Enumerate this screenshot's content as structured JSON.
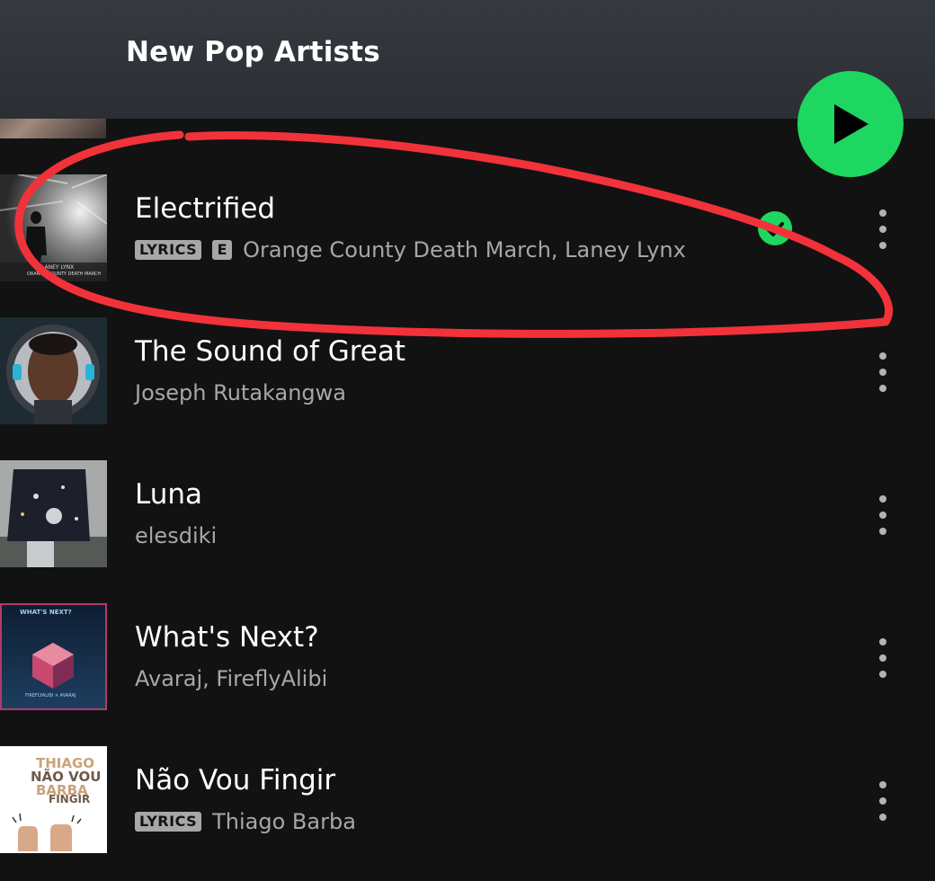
{
  "header": {
    "title": "New Pop Artists"
  },
  "play_button": {
    "icon": "play-icon",
    "color": "#1ed760"
  },
  "tracks": [
    {
      "title": "Electrified",
      "lyrics_badge": "LYRICS",
      "explicit_badge": "E",
      "artists": "Orange County Death March, Laney Lynx",
      "downloaded": true,
      "art_text_top": "LANEY LYNX",
      "art_text_bottom": "ORANGE COUNTY DEATH MARCH"
    },
    {
      "title": "The Sound of Great",
      "artists": "Joseph Rutakangwa"
    },
    {
      "title": "Luna",
      "artists": "elesdiki"
    },
    {
      "title": "What's Next?",
      "artists": "Avaraj, FireflyAlibi",
      "art_text": "WHAT'S NEXT?",
      "art_credit": "FIREFLYALIBI × AVARAJ"
    },
    {
      "title": "Não Vou Fingir",
      "lyrics_badge": "LYRICS",
      "artists": "Thiago Barba",
      "art_text_1": "THIAGO",
      "art_text_2": "NÃO VOU",
      "art_text_3": "BARBA",
      "art_text_4": "FINGIR"
    }
  ],
  "colors": {
    "background": "#121212",
    "header": "#2f3338",
    "accent": "#1ed760",
    "secondary_text": "#a7a7a7",
    "annotation": "#f2323a"
  }
}
